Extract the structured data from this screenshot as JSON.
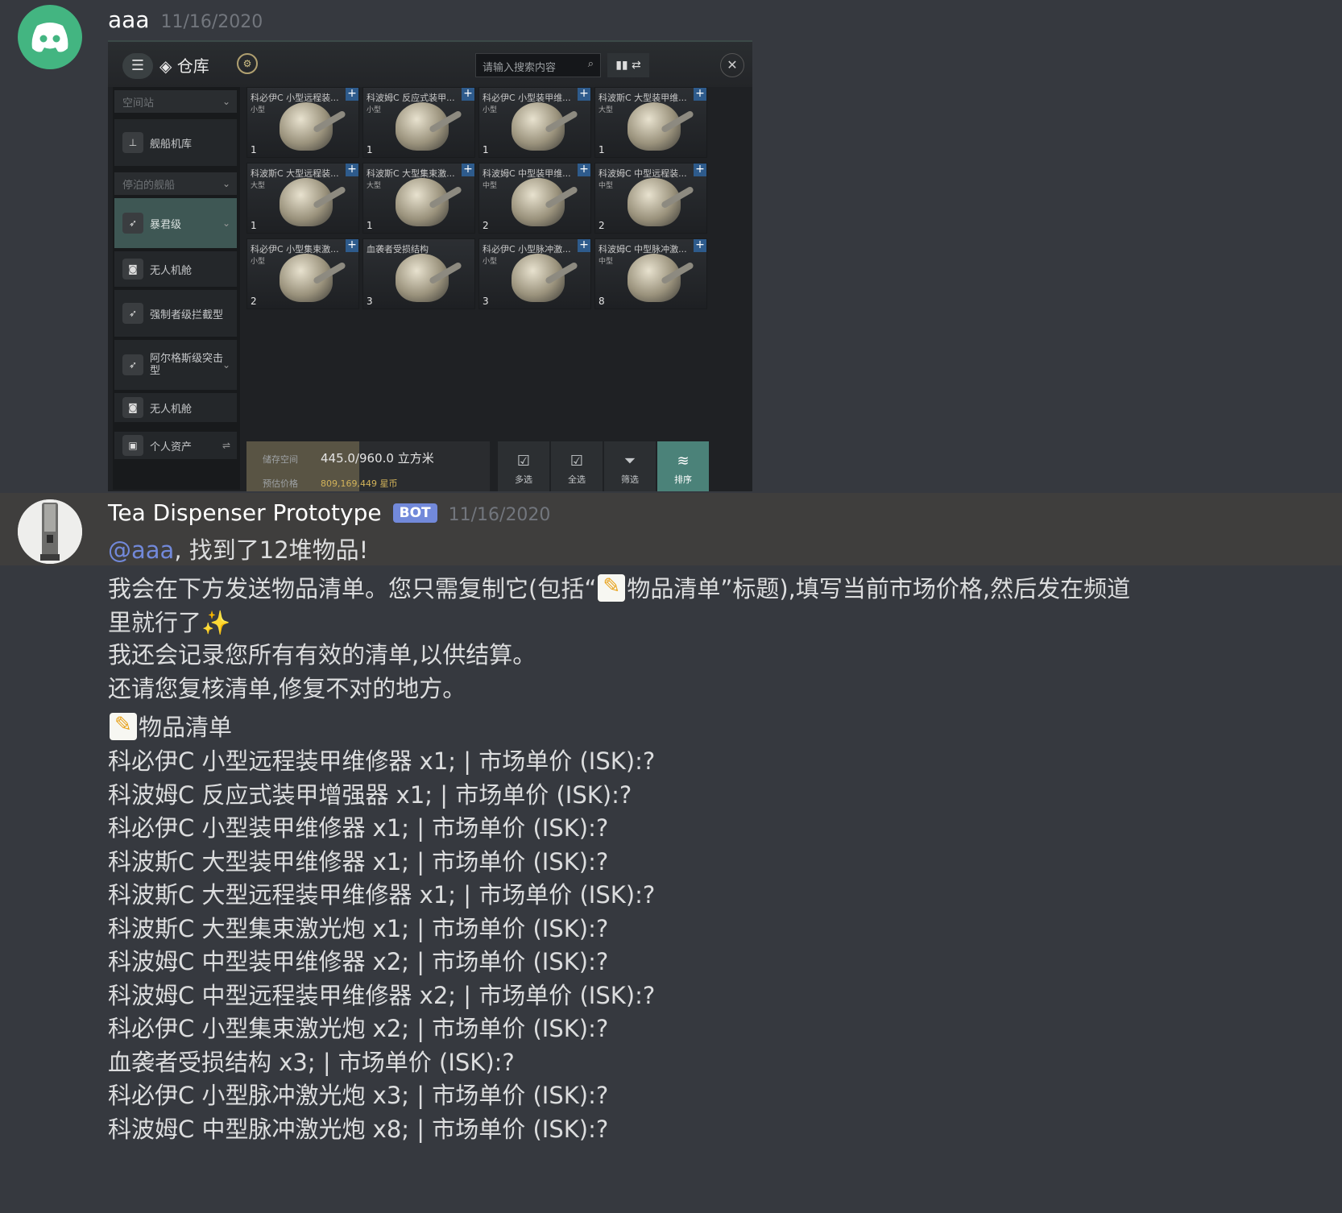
{
  "message1": {
    "username": "aaa",
    "timestamp": "11/16/2020",
    "avatar_icon": "discord-logo-icon",
    "attachment": {
      "window_title": "仓库",
      "search_placeholder": "请输入搜索内容",
      "sidebar": {
        "location_header": "空间站",
        "hangar": "舰船机库",
        "docked_header": "停泊的舰船",
        "ship1": "暴君级",
        "drone_bay1": "无人机舱",
        "ship2": "强制者级拦截型",
        "ship3": "阿尔格斯级突击型",
        "drone_bay2": "无人机舱",
        "personal_assets": "个人资产"
      },
      "items": [
        {
          "name": "科必伊C 小型远程装...",
          "size": "小型",
          "qty": "1"
        },
        {
          "name": "科波姆C 反应式装甲...",
          "size": "小型",
          "qty": "1"
        },
        {
          "name": "科必伊C 小型装甲维...",
          "size": "小型",
          "qty": "1"
        },
        {
          "name": "科波斯C 大型装甲维...",
          "size": "大型",
          "qty": "1"
        },
        {
          "name": "科波斯C 大型远程装...",
          "size": "大型",
          "qty": "1"
        },
        {
          "name": "科波斯C 大型集束激...",
          "size": "大型",
          "qty": "1"
        },
        {
          "name": "科波姆C 中型装甲维...",
          "size": "中型",
          "qty": "2"
        },
        {
          "name": "科波姆C 中型远程装...",
          "size": "中型",
          "qty": "2"
        },
        {
          "name": "科必伊C 小型集束激...",
          "size": "小型",
          "qty": "2"
        },
        {
          "name": "血袭者受损结构",
          "size": "",
          "qty": "3"
        },
        {
          "name": "科必伊C 小型脉冲激...",
          "size": "小型",
          "qty": "3"
        },
        {
          "name": "科波姆C 中型脉冲激...",
          "size": "中型",
          "qty": "8"
        }
      ],
      "storage_label": "储存空间",
      "storage_value": "445.0/960.0 立方米",
      "storage_fraction": 0.4635,
      "price_label": "预估价格",
      "price_value": "809,169,449 星币",
      "buttons": [
        "多选",
        "全选",
        "筛选",
        "排序"
      ]
    }
  },
  "message2": {
    "username": "Tea Dispenser Prototype",
    "bot_tag": "BOT",
    "timestamp": "11/16/2020",
    "mention": "@aaa",
    "found_text": ", 找到了12堆物品!",
    "intro_a": "我会在下方发送物品清单。您只需复制它(包括“",
    "intro_b": "物品清单”标题),填写当前市场价格,然后发在频道",
    "intro_c": "里就行了",
    "sparkle": "✨",
    "line_record": "我还会记录您所有有效的清单,以供结算。",
    "line_review": "还请您复核清单,修复不对的地方。",
    "list_title": "物品清单",
    "list": [
      "科必伊C 小型远程装甲维修器 x1; | 市场单价 (ISK):?",
      "科波姆C 反应式装甲增强器 x1; | 市场单价 (ISK):?",
      "科必伊C 小型装甲维修器 x1; | 市场单价 (ISK):?",
      "科波斯C 大型装甲维修器 x1; | 市场单价 (ISK):?",
      "科波斯C 大型远程装甲维修器 x1; | 市场单价 (ISK):?",
      "科波斯C 大型集束激光炮 x1; | 市场单价 (ISK):?",
      "科波姆C 中型装甲维修器 x2; | 市场单价 (ISK):?",
      "科波姆C 中型远程装甲维修器 x2; | 市场单价 (ISK):?",
      "科必伊C 小型集束激光炮 x2; | 市场单价 (ISK):?",
      "血袭者受损结构 x3; | 市场单价 (ISK):?",
      "科必伊C 小型脉冲激光炮 x3; | 市场单价 (ISK):?",
      "科波姆C 中型脉冲激光炮 x8; | 市场单价 (ISK):?"
    ]
  }
}
